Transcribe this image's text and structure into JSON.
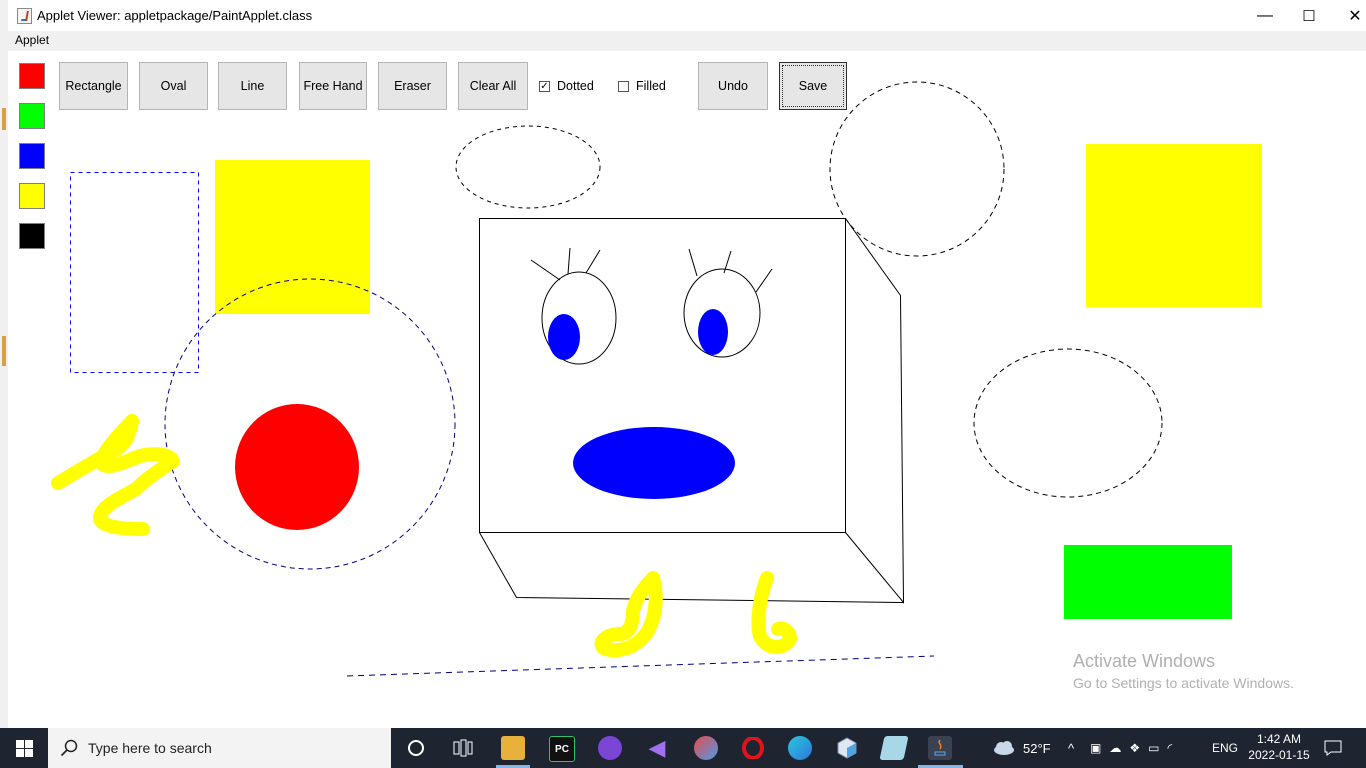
{
  "window": {
    "title": "Applet Viewer: appletpackage/PaintApplet.class",
    "controls": {
      "minimize": "—",
      "maximize": "☐",
      "close": "✕"
    }
  },
  "menubar": {
    "items": [
      "Applet"
    ]
  },
  "palette": {
    "colors": [
      "#ff0000",
      "#00ff00",
      "#0000ff",
      "#ffff00",
      "#000000"
    ]
  },
  "toolbar": {
    "buttons": [
      "Rectangle",
      "Oval",
      "Line",
      "Free Hand",
      "Eraser",
      "Clear All"
    ],
    "dotted": {
      "label": "Dotted",
      "checked": true
    },
    "filled": {
      "label": "Filled",
      "checked": false
    },
    "undo": "Undo",
    "save": "Save"
  },
  "watermark": {
    "line1": "Activate Windows",
    "line2": "Go to Settings to activate Windows."
  },
  "taskbar": {
    "search_placeholder": "Type here to search",
    "weather": "52°F",
    "language": "ENG",
    "time": "1:42 AM",
    "date": "2022-01-15",
    "apps": [
      "cortana-icon",
      "task-view-icon",
      "file-explorer-icon",
      "pycharm-icon",
      "podcast-icon",
      "visual-studio-icon",
      "paint-icon",
      "opera-icon",
      "edge-icon",
      "box-app-icon",
      "notepad-icon",
      "java-icon"
    ]
  }
}
